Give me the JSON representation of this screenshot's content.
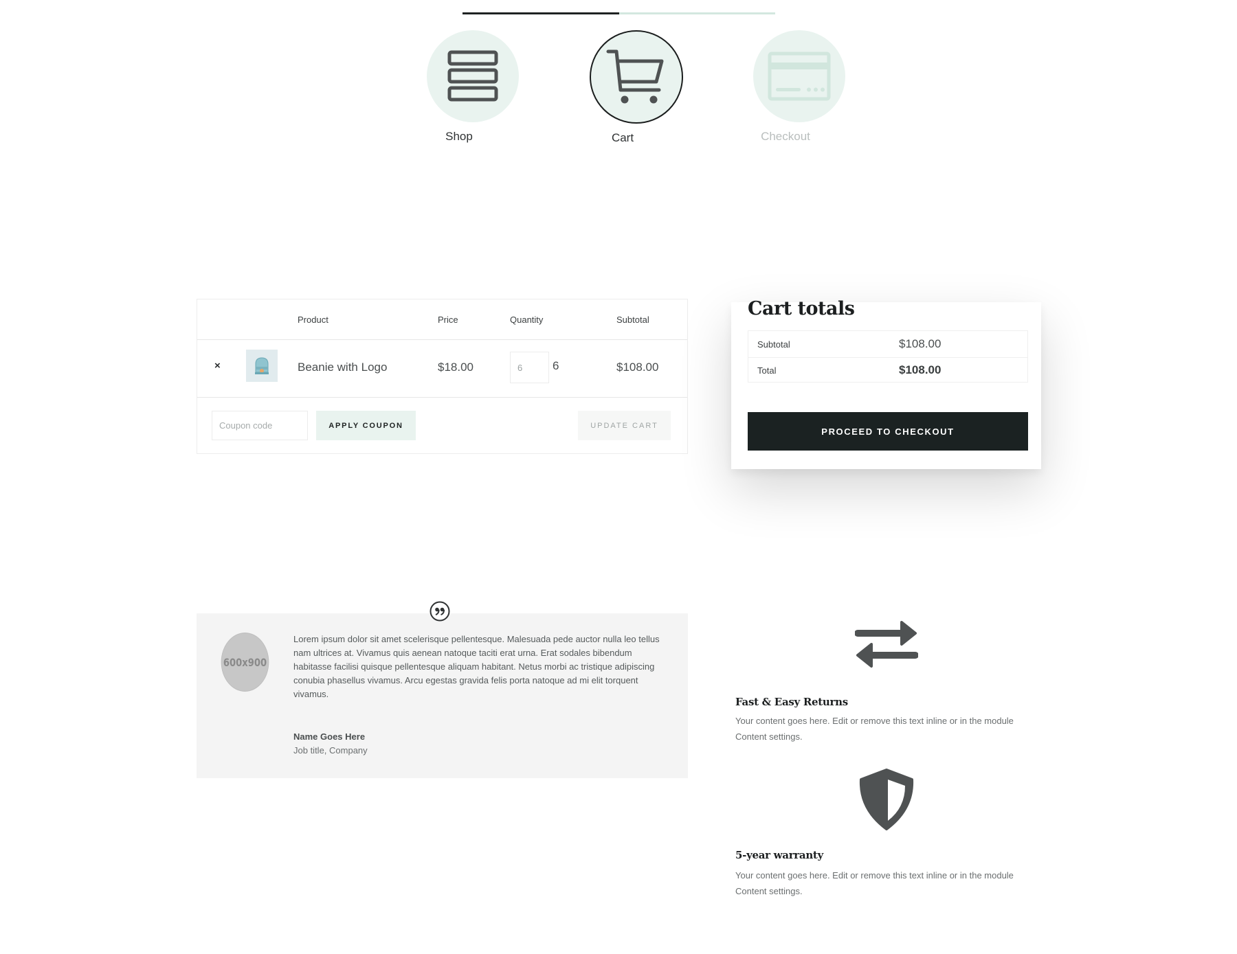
{
  "progress": {
    "completed_fraction": 0.5,
    "colors": {
      "done": "#1e2222",
      "remaining": "#d3e7df",
      "circle": "#e9f3ef"
    },
    "steps": [
      {
        "label": "Shop",
        "icon": "server-stack-icon",
        "state": "done"
      },
      {
        "label": "Cart",
        "icon": "shopping-cart-icon",
        "state": "active"
      },
      {
        "label": "Checkout",
        "icon": "credit-card-icon",
        "state": "upcoming"
      }
    ]
  },
  "cart": {
    "headers": {
      "product": "Product",
      "price": "Price",
      "quantity": "Quantity",
      "subtotal": "Subtotal"
    },
    "items": [
      {
        "remove_label": "×",
        "thumbnail": "beanie-thumbnail",
        "name": "Beanie with Logo",
        "price": "$18.00",
        "quantity_input": "6",
        "quantity_display": "6",
        "subtotal": "$108.00"
      }
    ],
    "coupon": {
      "placeholder": "Coupon code",
      "value": ""
    },
    "apply_coupon_label": "APPLY COUPON",
    "update_cart_label": "UPDATE CART"
  },
  "totals": {
    "title": "Cart totals",
    "rows": [
      {
        "label": "Subtotal",
        "value": "$108.00"
      },
      {
        "label": "Total",
        "value": "$108.00"
      }
    ],
    "checkout_label": "PROCEED TO CHECKOUT",
    "checkout_color": "#1b2222"
  },
  "testimonial": {
    "avatar_placeholder": "600x900",
    "quote": "Lorem ipsum dolor sit amet scelerisque pellentesque. Malesuada pede auctor nulla leo tellus nam ultrices at. Vivamus quis aenean natoque taciti erat urna. Erat sodales bibendum habitasse facilisi quisque pellentesque aliquam habitant. Netus morbi ac tristique adipiscing conubia phasellus vivamus. Arcu egestas gravida felis porta natoque ad mi elit torquent vivamus.",
    "author_name": "Name Goes Here",
    "author_title": "Job title, Company"
  },
  "features": [
    {
      "icon": "exchange-arrows-icon",
      "title": "Fast & Easy Returns",
      "body": "Your content goes here. Edit or remove this text inline or in the module Content settings."
    },
    {
      "icon": "shield-icon",
      "title": "5-year warranty",
      "body": "Your content goes here. Edit or remove this text inline or in the module Content settings."
    }
  ]
}
